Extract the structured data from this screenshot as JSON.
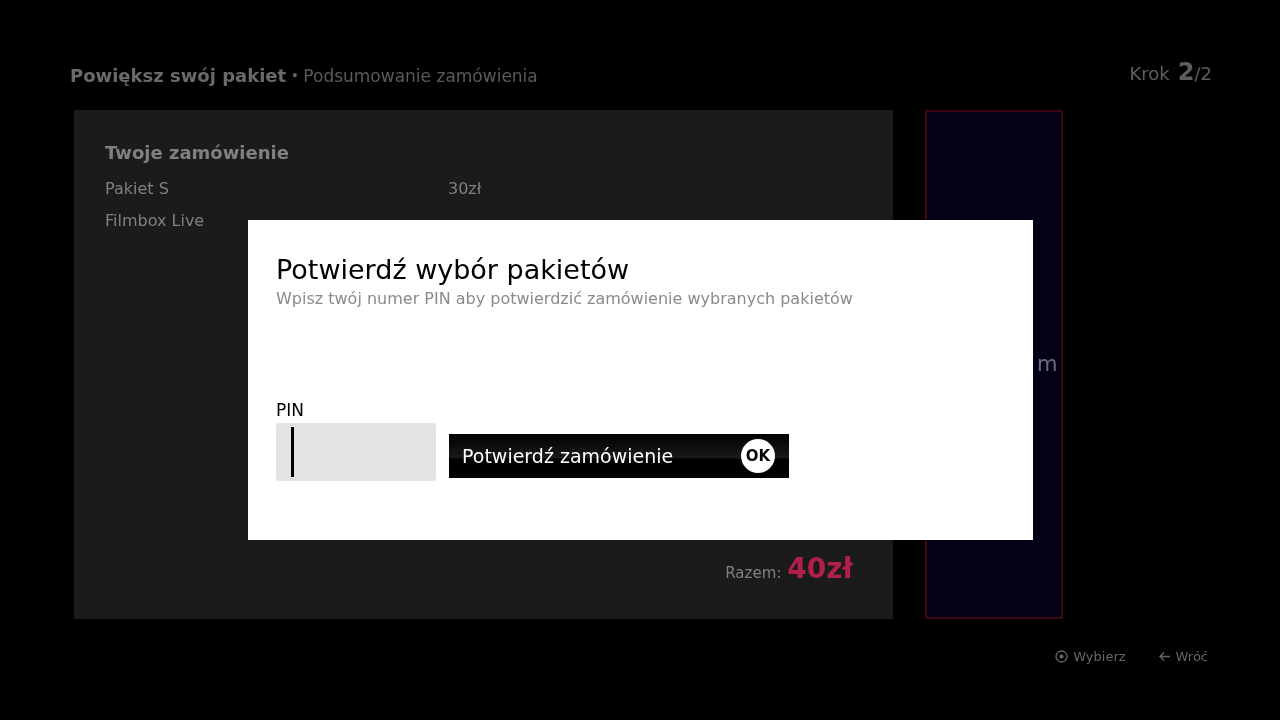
{
  "header": {
    "title": "Powiększ swój pakiet",
    "separator": "·",
    "subtitle": "Podsumowanie zamówienia",
    "step_label": "Krok",
    "step_current": "2",
    "step_total": "/2"
  },
  "order": {
    "title": "Twoje zamówienie",
    "items": [
      {
        "name": "Pakiet S",
        "price": "30zł"
      },
      {
        "name": "Filmbox Live"
      }
    ],
    "total_label": "Razem:",
    "total_value": "40zł"
  },
  "side_panel": {
    "text": "m"
  },
  "dialog": {
    "title": "Potwierdź wybór pakietów",
    "subtitle": "Wpisz twój numer PIN aby potwierdzić zamówienie wybranych pakietów",
    "pin_label": "PIN",
    "confirm_button": "Potwierdź zamówienie",
    "ok_badge": "OK"
  },
  "footer": {
    "hints": [
      {
        "kind": "select",
        "label": "Wybierz"
      },
      {
        "kind": "back",
        "label": "Wróć"
      }
    ]
  }
}
